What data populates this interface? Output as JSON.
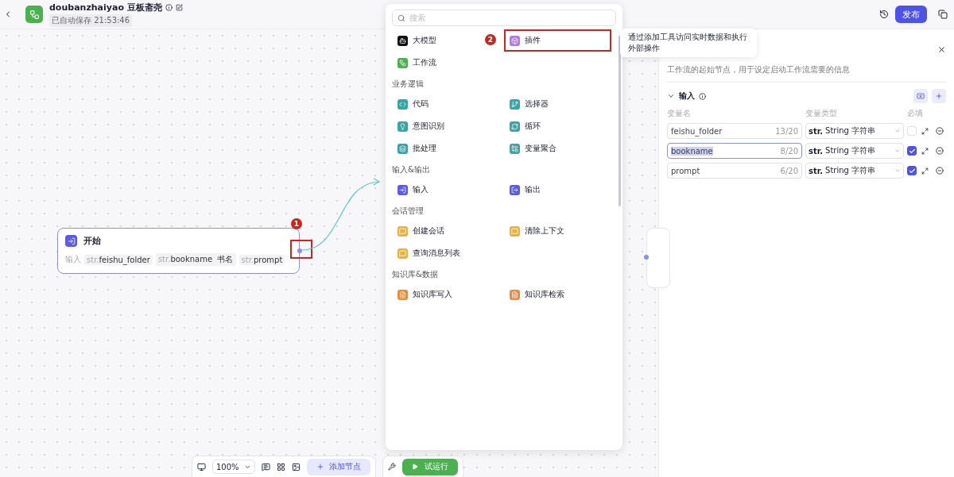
{
  "header": {
    "name": "doubanzhaiyao",
    "title": "豆板斋尧",
    "autosave": "已自动保存 21:53:46",
    "publish": "发布"
  },
  "node": {
    "title": "开始",
    "input_label": "输入",
    "tags": [
      {
        "prefix": "str.",
        "name": "feishu_folder"
      },
      {
        "prefix": "str.",
        "name": "bookname",
        "desc": "书名"
      },
      {
        "prefix": "str.",
        "name": "prompt"
      }
    ]
  },
  "annotations": [
    "1",
    "2"
  ],
  "menu": {
    "search_placeholder": "搜索",
    "groups": [
      {
        "items": [
          {
            "label": "大模型",
            "color": "#111111",
            "selected": false
          },
          {
            "label": "插件",
            "color": "#b178f0",
            "selected": true
          },
          {
            "label": "工作流",
            "color": "#4caf50",
            "selected": false
          }
        ]
      },
      {
        "title": "业务逻辑",
        "items": [
          {
            "label": "代码",
            "color": "#3aa5a5",
            "selected": false
          },
          {
            "label": "选择器",
            "color": "#3aa5a5",
            "selected": false
          },
          {
            "label": "意图识别",
            "color": "#3aa5a5",
            "selected": false
          },
          {
            "label": "循环",
            "color": "#3aa5a5",
            "selected": false
          },
          {
            "label": "批处理",
            "color": "#3aa5a5",
            "selected": false
          },
          {
            "label": "变量聚合",
            "color": "#3aa5a5",
            "selected": false
          }
        ]
      },
      {
        "title": "输入&输出",
        "items": [
          {
            "label": "输入",
            "color": "#5b5ce6",
            "selected": false
          },
          {
            "label": "输出",
            "color": "#5b5ce6",
            "selected": false
          }
        ]
      },
      {
        "title": "会话管理",
        "items": [
          {
            "label": "创建会话",
            "color": "#e8b33c",
            "selected": false
          },
          {
            "label": "清除上下文",
            "color": "#e8b33c",
            "selected": false
          },
          {
            "label": "查询消息列表",
            "color": "#e8b33c",
            "selected": false
          }
        ]
      },
      {
        "title": "知识库&数据",
        "items": [
          {
            "label": "知识库写入",
            "color": "#ea8a3c",
            "selected": false
          },
          {
            "label": "知识库检索",
            "color": "#ea8a3c",
            "selected": false
          }
        ]
      }
    ]
  },
  "tooltip": "通过添加工具访问实时数据和执行外部操作",
  "panel": {
    "description": "工作流的起始节点，用于设定启动工作流需要的信息",
    "section": "输入",
    "columns": [
      "变量名",
      "变量类型",
      "必填"
    ],
    "rows": [
      {
        "name": "feishu_folder",
        "count": "13/20",
        "type_prefix": "str.",
        "type": "String",
        "type_desc": "字符串",
        "required": false,
        "focused": false
      },
      {
        "name": "bookname",
        "count": "8/20",
        "type_prefix": "str.",
        "type": "String",
        "type_desc": "字符串",
        "required": true,
        "focused": true
      },
      {
        "name": "prompt",
        "count": "6/20",
        "type_prefix": "str.",
        "type": "String",
        "type_desc": "字符串",
        "required": true,
        "focused": false
      }
    ]
  },
  "toolbar": {
    "zoom": "100%",
    "add_node": "添加节点",
    "run": "试运行"
  }
}
